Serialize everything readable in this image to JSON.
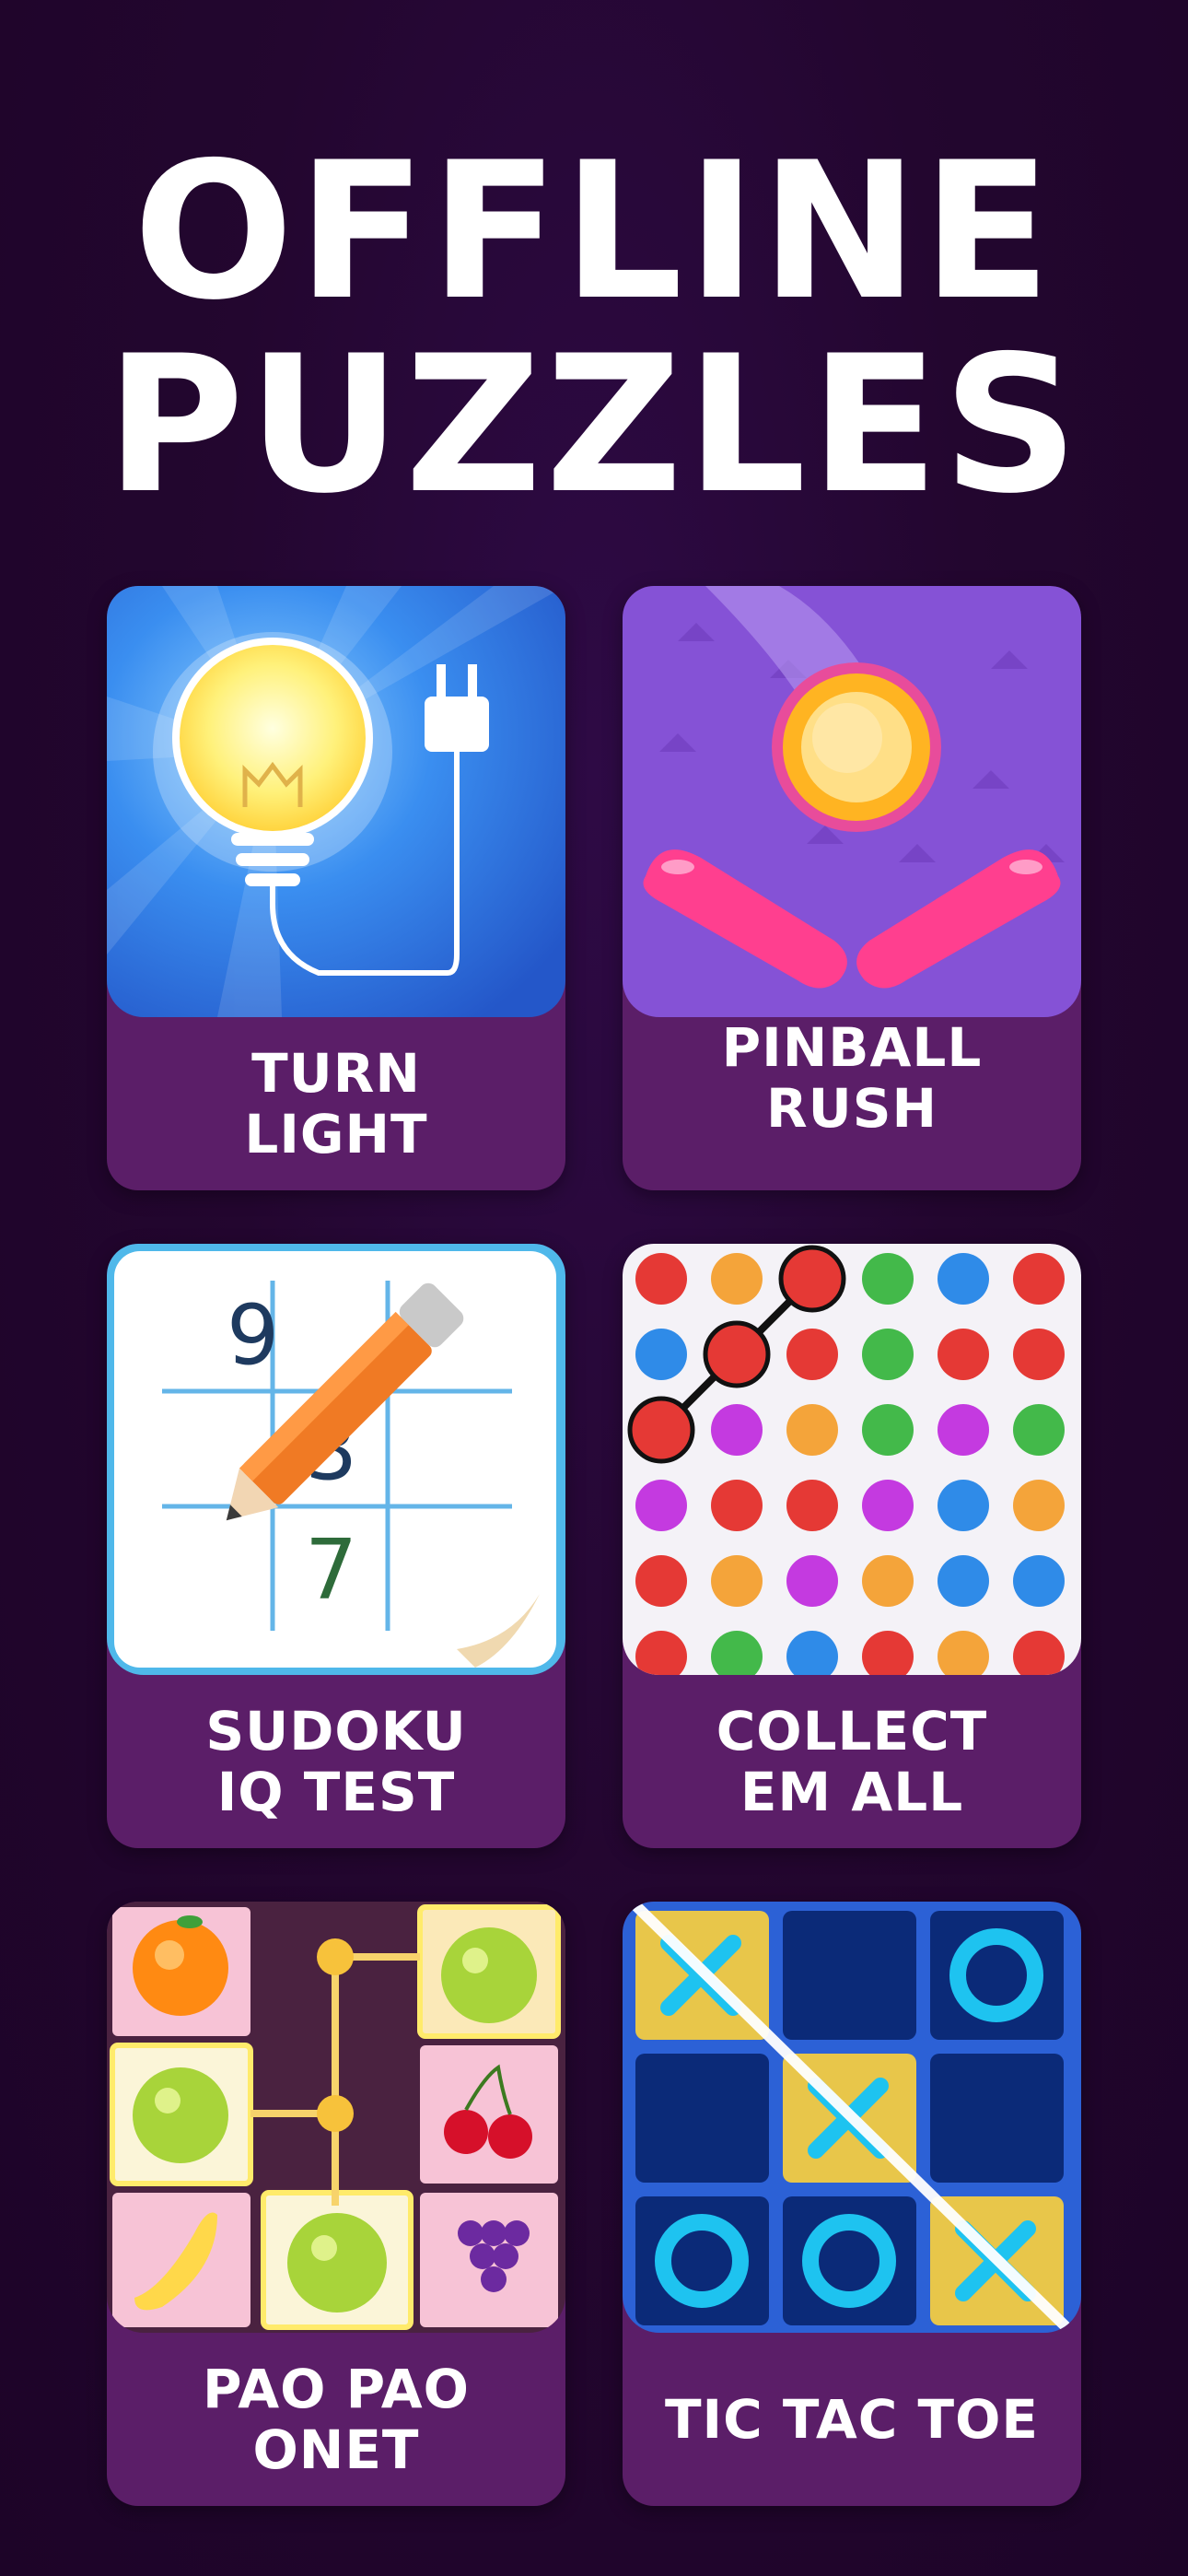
{
  "header": {
    "line1": "OFFLINE",
    "line2": "PUZZLES"
  },
  "games": [
    {
      "line1": "TURN",
      "line2": "LIGHT",
      "icon": "lightbulb-plug-icon"
    },
    {
      "line1": "PINBALL",
      "line2": "RUSH",
      "icon": "pinball-icon"
    },
    {
      "line1": "SUDOKU",
      "line2": "IQ TEST",
      "icon": "sudoku-pencil-icon",
      "digits": [
        "9",
        "3",
        "7"
      ]
    },
    {
      "line1": "COLLECT",
      "line2": "EM ALL",
      "icon": "color-dots-icon"
    },
    {
      "line1": "PAO PAO",
      "line2": "ONET",
      "icon": "fruit-match-icon"
    },
    {
      "line1": "TIC TAC TOE",
      "line2": "",
      "icon": "tic-tac-toe-icon"
    }
  ],
  "colors": {
    "background": "#23062f",
    "card": "#5b1e68",
    "text": "#ffffff"
  }
}
